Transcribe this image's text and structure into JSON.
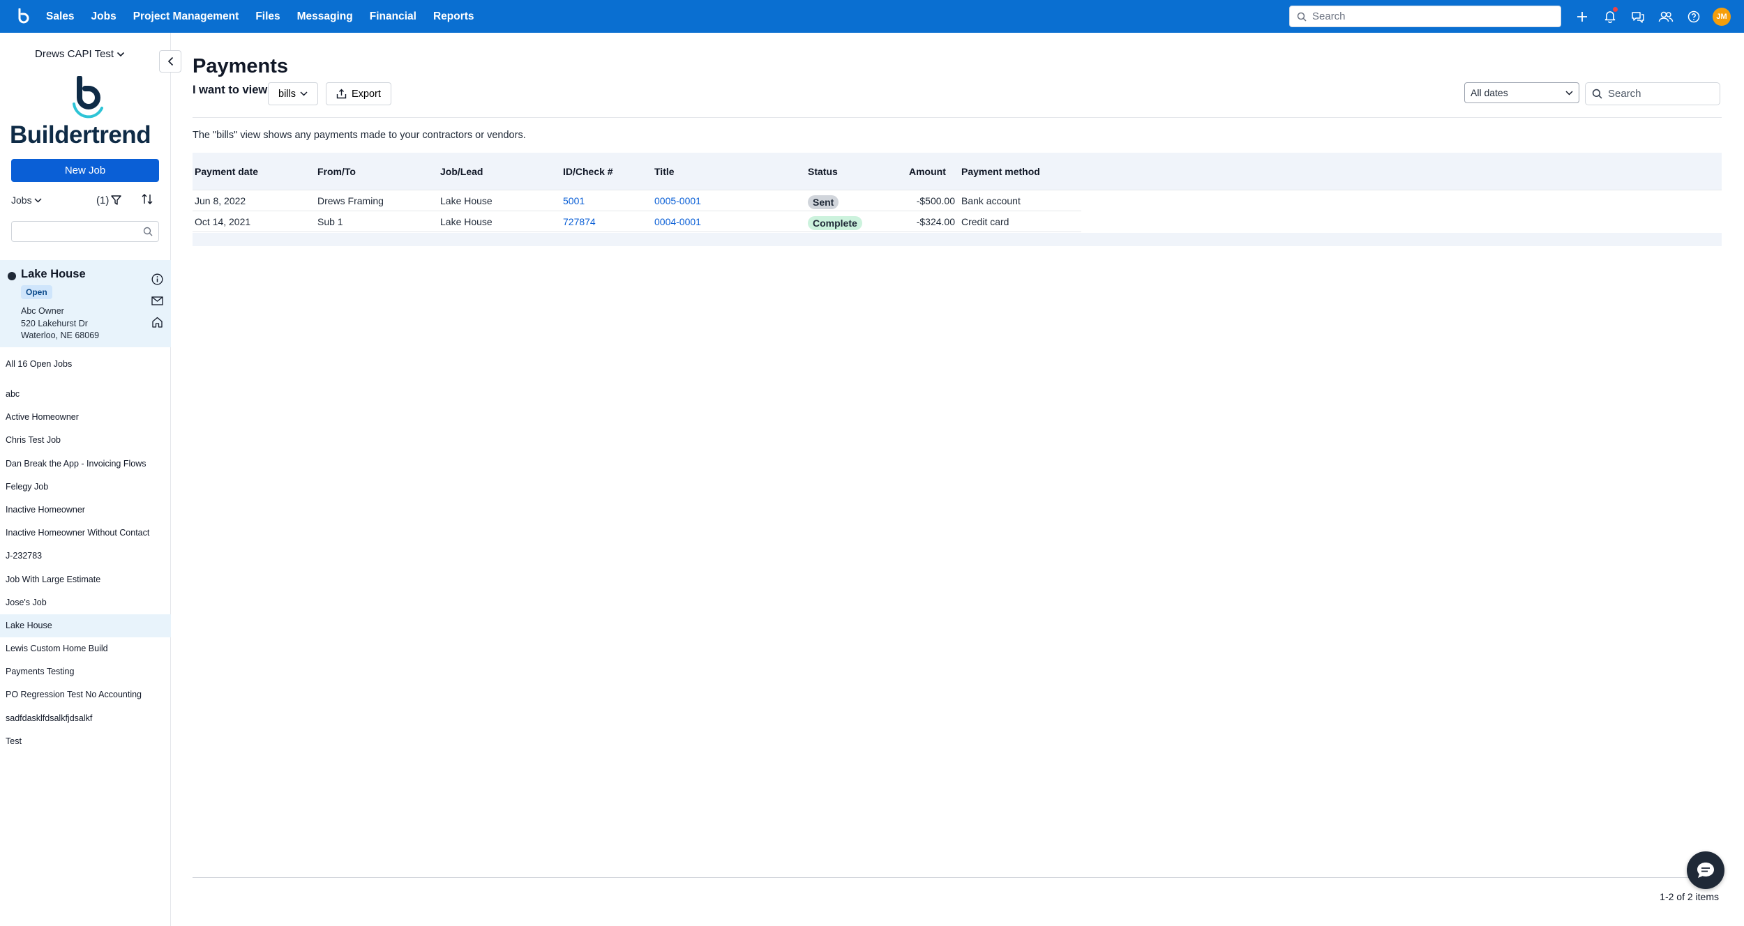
{
  "topbar": {
    "nav": [
      "Sales",
      "Jobs",
      "Project Management",
      "Files",
      "Messaging",
      "Financial",
      "Reports"
    ],
    "search_placeholder": "Search",
    "avatar_initials": "JM"
  },
  "sidebar": {
    "account": "Drews CAPI Test",
    "brand": "Buildertrend",
    "new_job_label": "New Job",
    "jobs_label": "Jobs",
    "filter_count": "(1)",
    "selected_job": {
      "name": "Lake House",
      "status": "Open",
      "owner": "Abc Owner",
      "street": "520 Lakehurst Dr",
      "city": "Waterloo, NE 68069"
    },
    "all_jobs_label": "All 16 Open Jobs",
    "jobs": [
      "abc",
      "Active Homeowner",
      "Chris Test Job",
      "Dan Break the App - Invoicing Flows",
      "Felegy Job",
      "Inactive Homeowner",
      "Inactive Homeowner Without Contact",
      "J-232783",
      "Job With Large Estimate",
      "Jose's Job",
      "Lake House",
      "Lewis Custom Home Build",
      "Payments Testing",
      "PO Regression Test No Accounting",
      "sadfdasklfdsalkfjdsalkf",
      "Test"
    ],
    "active_job_index": 10
  },
  "main": {
    "title": "Payments",
    "want_label": "I want to view",
    "view_value": "bills",
    "export_label": "Export",
    "dates_value": "All dates",
    "search_placeholder": "Search",
    "description": "The \"bills\" view shows any payments made to your contractors or vendors.",
    "columns": {
      "date": "Payment date",
      "from": "From/To",
      "job": "Job/Lead",
      "id": "ID/Check #",
      "title": "Title",
      "status": "Status",
      "amount": "Amount",
      "method": "Payment method"
    },
    "rows": [
      {
        "date": "Jun 8, 2022",
        "from": "Drews Framing",
        "job": "Lake House",
        "id": "5001",
        "title": "0005-0001",
        "status": "Sent",
        "amount": "-$500.00",
        "method": "Bank account"
      },
      {
        "date": "Oct 14, 2021",
        "from": "Sub 1",
        "job": "Lake House",
        "id": "727874",
        "title": "0004-0001",
        "status": "Complete",
        "amount": "-$324.00",
        "method": "Credit card"
      }
    ],
    "pager": "1-2 of 2 items"
  }
}
